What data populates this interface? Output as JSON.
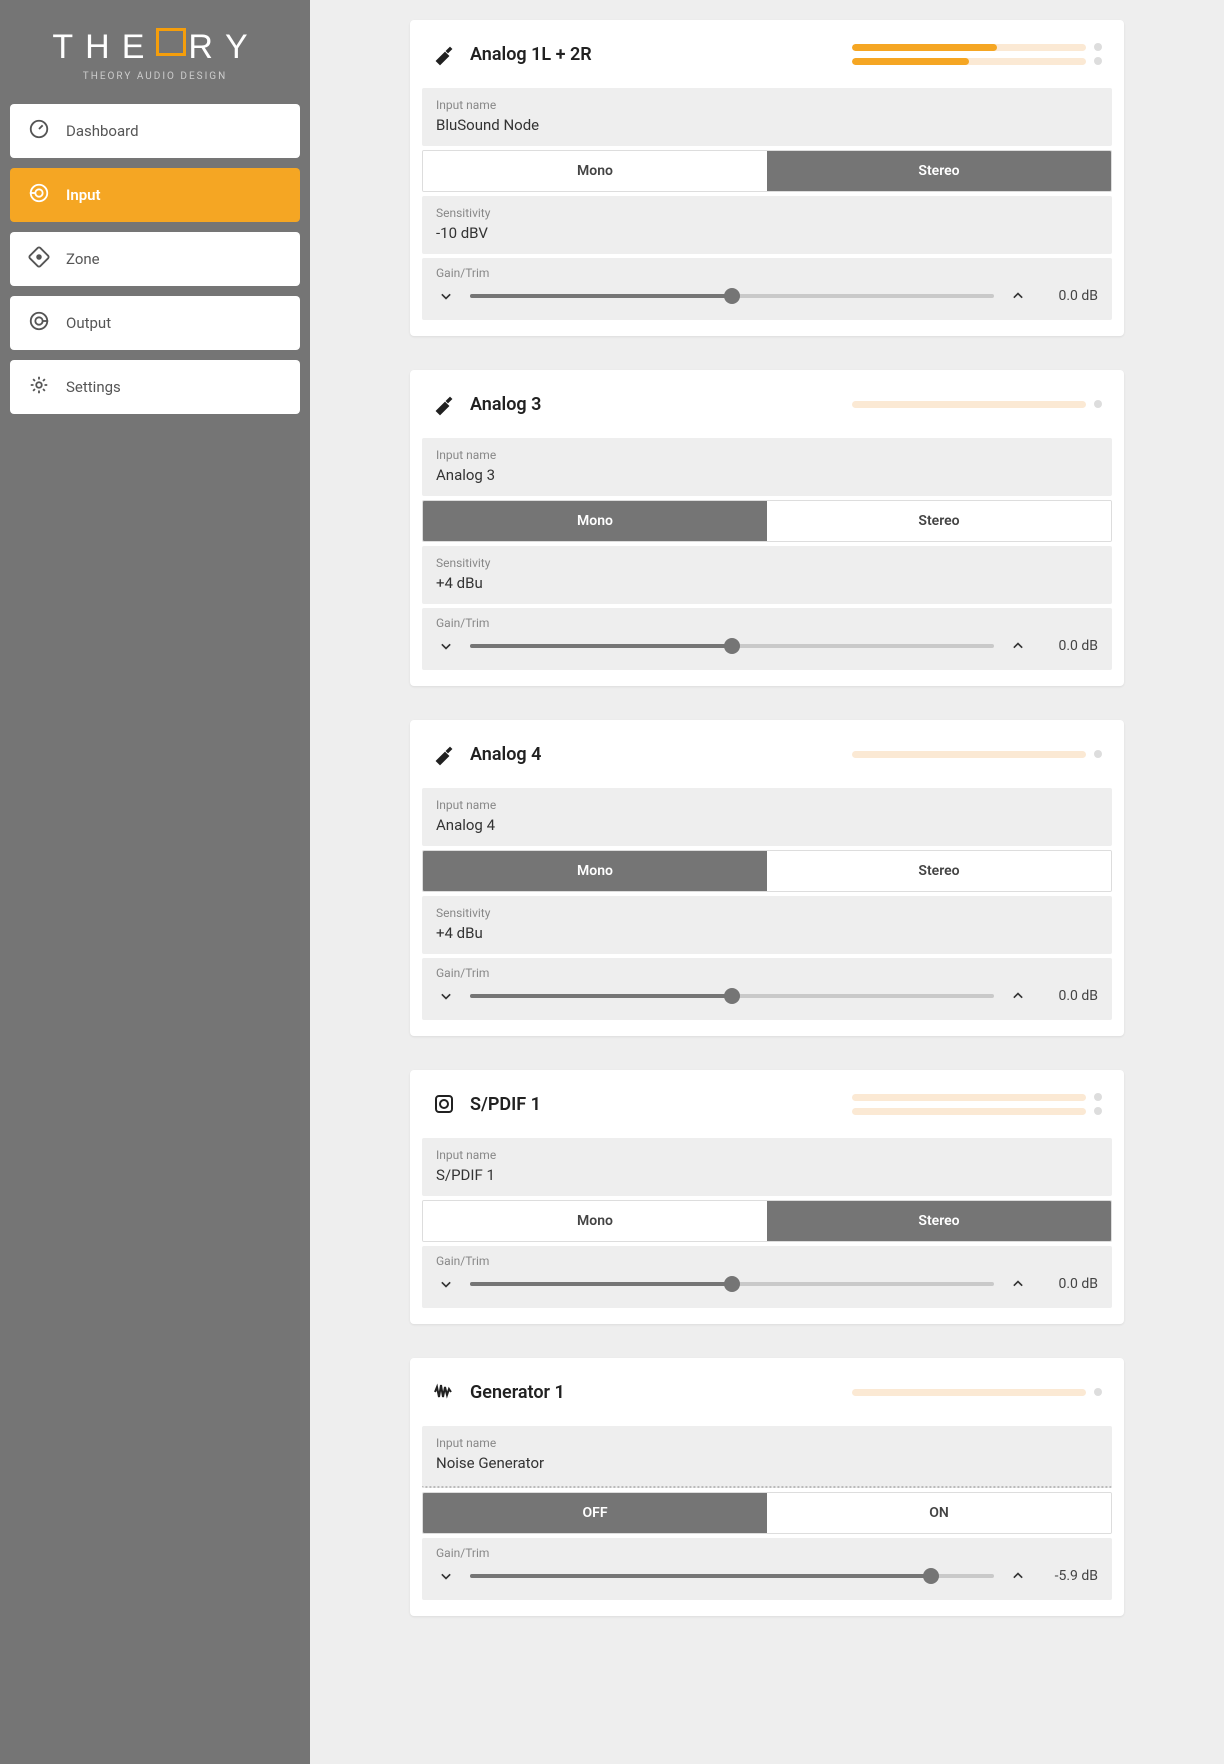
{
  "brand": {
    "name": "THEORY",
    "sub": "THEORY AUDIO DESIGN"
  },
  "sidebar": {
    "items": [
      {
        "label": "Dashboard",
        "icon": "gauge-icon",
        "active": false
      },
      {
        "label": "Input",
        "icon": "input-icon",
        "active": true
      },
      {
        "label": "Zone",
        "icon": "zone-icon",
        "active": false
      },
      {
        "label": "Output",
        "icon": "output-icon",
        "active": false
      },
      {
        "label": "Settings",
        "icon": "gear-icon",
        "active": false
      }
    ]
  },
  "labels": {
    "input_name": "Input name",
    "sensitivity": "Sensitivity",
    "gain_trim": "Gain/Trim",
    "mono": "Mono",
    "stereo": "Stereo",
    "off": "OFF",
    "on": "ON"
  },
  "inputs": [
    {
      "icon": "jack-icon",
      "title": "Analog 1L + 2R",
      "name": "BluSound Node",
      "mode_options": [
        "Mono",
        "Stereo"
      ],
      "mode_selected": "Stereo",
      "has_sensitivity": true,
      "sensitivity": "-10 dBV",
      "gain_pct": 50,
      "gain_text": "0.0 dB",
      "meters": [
        62,
        50
      ]
    },
    {
      "icon": "jack-icon",
      "title": "Analog 3",
      "name": "Analog 3",
      "mode_options": [
        "Mono",
        "Stereo"
      ],
      "mode_selected": "Mono",
      "has_sensitivity": true,
      "sensitivity": "+4 dBu",
      "gain_pct": 50,
      "gain_text": "0.0 dB",
      "meters": [
        0
      ]
    },
    {
      "icon": "jack-icon",
      "title": "Analog 4",
      "name": "Analog 4",
      "mode_options": [
        "Mono",
        "Stereo"
      ],
      "mode_selected": "Mono",
      "has_sensitivity": true,
      "sensitivity": "+4 dBu",
      "gain_pct": 50,
      "gain_text": "0.0 dB",
      "meters": [
        0
      ]
    },
    {
      "icon": "spdif-icon",
      "title": "S/PDIF 1",
      "name": "S/PDIF 1",
      "mode_options": [
        "Mono",
        "Stereo"
      ],
      "mode_selected": "Stereo",
      "has_sensitivity": false,
      "sensitivity": "",
      "gain_pct": 50,
      "gain_text": "0.0 dB",
      "meters": [
        0,
        0
      ]
    },
    {
      "icon": "wave-icon",
      "title": "Generator 1",
      "name": "Noise Generator",
      "name_dotted": true,
      "mode_options": [
        "OFF",
        "ON"
      ],
      "mode_selected": "OFF",
      "has_sensitivity": false,
      "sensitivity": "",
      "gain_pct": 88,
      "gain_text": "-5.9 dB",
      "meters": [
        0
      ]
    }
  ]
}
